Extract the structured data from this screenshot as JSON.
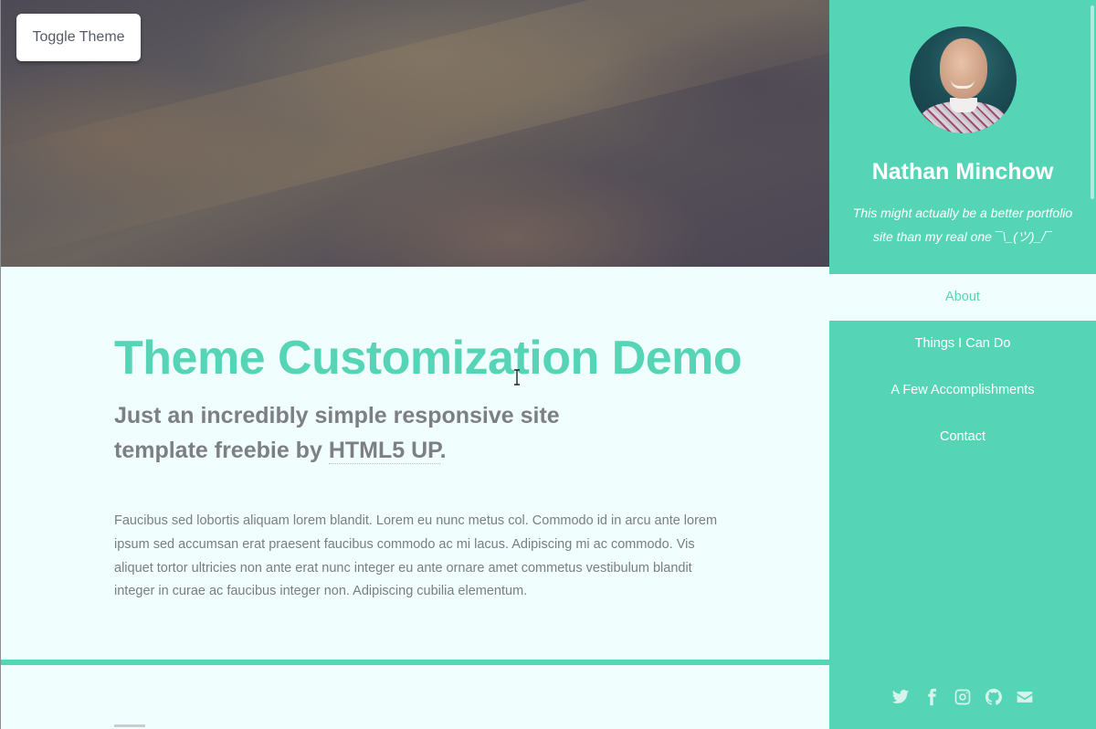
{
  "theme": {
    "accent": "#56d4b6",
    "background": "#f0fefd",
    "text": "#7a7d82"
  },
  "toolbar": {
    "toggle_label": "Toggle Theme"
  },
  "main": {
    "title": "Theme Customization Demo",
    "subtitle_prefix": "Just an incredibly simple responsive site template freebie by ",
    "subtitle_link": "HTML5 UP",
    "subtitle_suffix": ".",
    "body": "Faucibus sed lobortis aliquam lorem blandit. Lorem eu nunc metus col. Commodo id in arcu ante lorem ipsum sed accumsan erat praesent faucibus commodo ac mi lacus. Adipiscing mi ac commodo. Vis aliquet tortor ultricies non ante erat nunc integer eu ante ornare amet commetus vestibulum blandit integer in curae ac faucibus integer non. Adipiscing cubilia elementum."
  },
  "sidebar": {
    "name": "Nathan Minchow",
    "tagline": "This might actually be a better portfolio site than my real one ¯\\_(ツ)_/¯",
    "nav": [
      {
        "label": "About",
        "active": true
      },
      {
        "label": "Things I Can Do",
        "active": false
      },
      {
        "label": "A Few Accomplishments",
        "active": false
      },
      {
        "label": "Contact",
        "active": false
      }
    ],
    "social_icons": [
      "twitter-icon",
      "facebook-icon",
      "instagram-icon",
      "github-icon",
      "email-icon"
    ]
  }
}
